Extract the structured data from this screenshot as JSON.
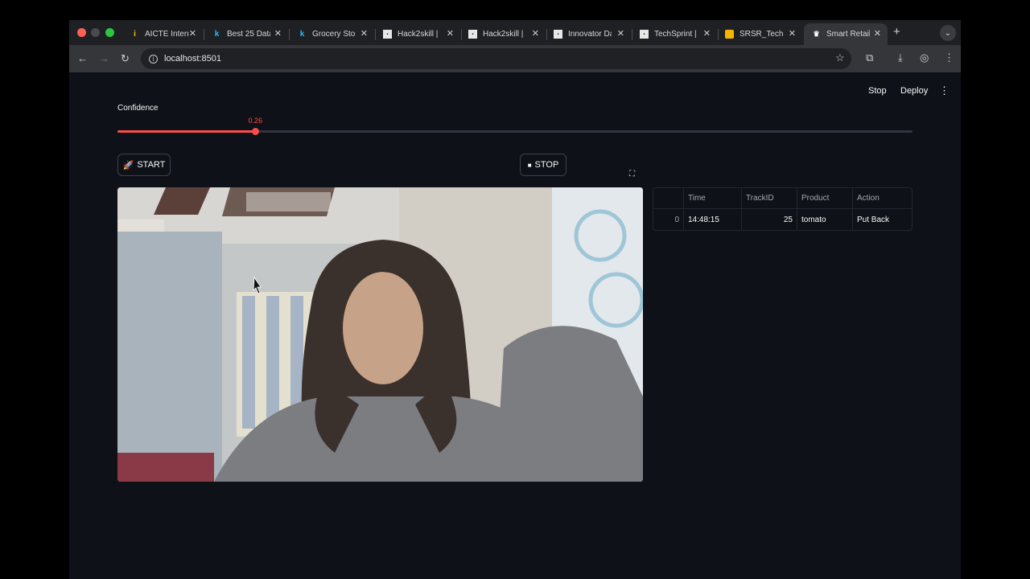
{
  "browser": {
    "tabs": [
      {
        "title": "AICTE Intern",
        "favicon": "aicte"
      },
      {
        "title": "Best 25 Data",
        "favicon": "kaggle"
      },
      {
        "title": "Grocery Sto",
        "favicon": "kaggle"
      },
      {
        "title": "Hack2skill |",
        "favicon": "hack2skill"
      },
      {
        "title": "Hack2skill |",
        "favicon": "hack2skill"
      },
      {
        "title": "Innovator Da",
        "favicon": "hack2skill"
      },
      {
        "title": "TechSprint |",
        "favicon": "hack2skill"
      },
      {
        "title": "SRSR_Techs",
        "favicon": "slides"
      },
      {
        "title": "Smart Retail",
        "favicon": "streamlit",
        "active": true
      }
    ],
    "url": "localhost:8501"
  },
  "header": {
    "stop_label": "Stop",
    "deploy_label": "Deploy"
  },
  "slider": {
    "label": "Confidence",
    "value": 0.26,
    "value_text": "0.26",
    "min": 0,
    "max": 1
  },
  "controls": {
    "start_label": "START",
    "start_icon": "🚀",
    "stop_label": "STOP",
    "stop_icon": "■"
  },
  "table": {
    "columns": [
      "",
      "Time",
      "TrackID",
      "Product",
      "Action"
    ],
    "rows": [
      {
        "index": "0",
        "time": "14:48:15",
        "track_id": "25",
        "product": "tomato",
        "action": "Put Back"
      }
    ]
  },
  "colors": {
    "accent": "#ff4b4b",
    "background": "#0e1117"
  }
}
